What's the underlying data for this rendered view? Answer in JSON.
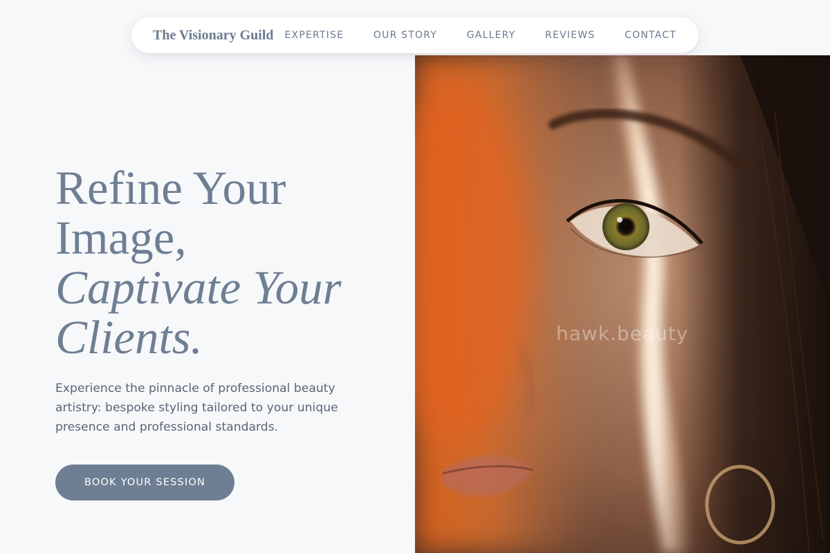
{
  "nav": {
    "brand": "The Visionary Guild",
    "links": [
      {
        "label": "EXPERTISE"
      },
      {
        "label": "OUR STORY"
      },
      {
        "label": "GALLERY"
      },
      {
        "label": "REVIEWS"
      },
      {
        "label": "CONTACT"
      }
    ]
  },
  "hero": {
    "headline": {
      "line1": "Refine Your",
      "line2": "Image,",
      "line3": "Captivate Your",
      "line4": "Clients."
    },
    "subtext": "Experience the pinnacle of professional beauty artistry: bespoke styling tailored to your unique presence and professional standards.",
    "cta_label": "BOOK YOUR SESSION",
    "image": {
      "watermark": "hawk.beauty"
    }
  },
  "colors": {
    "accent": "#6e7e93",
    "background": "#f7f8fa",
    "text": "#5a6474"
  }
}
